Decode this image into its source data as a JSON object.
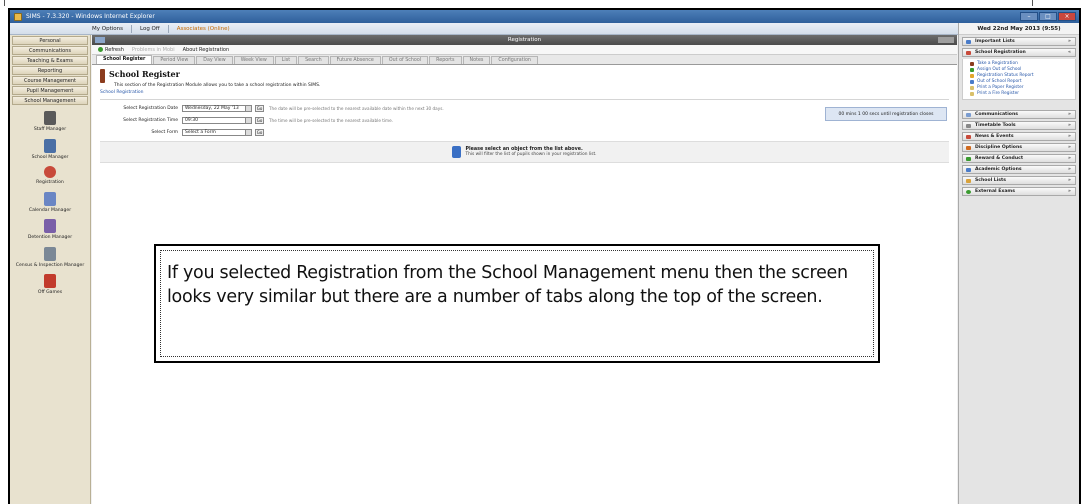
{
  "window": {
    "title": "SIMS - 7.3.320 - Windows Internet Explorer"
  },
  "toolbar": {
    "my_options": "My Options",
    "log_off": "Log Off",
    "user": "Associates (Online)"
  },
  "leftnav": {
    "menus": [
      "Personal",
      "Communications",
      "Teaching & Exams",
      "Reporting",
      "Course Management",
      "Pupil Management",
      "School Management"
    ],
    "tools": [
      "Staff Manager",
      "School Manager",
      "Registration",
      "Calendar Manager",
      "Detention Manager",
      "Census & Inspection Manager",
      "Off Games"
    ]
  },
  "panel": {
    "title": "Registration"
  },
  "subbar": {
    "refresh": "Refresh",
    "problem": "Problems in Mobi",
    "about": "About Registration"
  },
  "tabs": [
    "School Register",
    "Period View",
    "Day View",
    "Week View",
    "List",
    "Search",
    "Future Absence",
    "Out of School",
    "Reports",
    "Notes",
    "Configuration"
  ],
  "register": {
    "title": "School Register",
    "desc": "This section of the Registration Module allows you to take a school registration within SIMS.",
    "crumb": "School Registration",
    "countdown": "00 mins 1 00 secs until registration closes"
  },
  "form": {
    "date_label": "Select Registration Date",
    "date_value": "Wednesday, 22 May '13",
    "date_hint": "The date will be pre-selected to the nearest available date within the next 30 days.",
    "time_label": "Select Registration Time",
    "time_value": "09:30",
    "time_hint": "The time will be pre-selected to the nearest available time.",
    "form_label": "Select Form",
    "form_value": "Select a Form",
    "go": "Go"
  },
  "info": {
    "line1": "Please select an object from the list above.",
    "line2": "This will filter the list of pupils shown in your registration list."
  },
  "note": {
    "text": "If you selected Registration from the School Management menu then the screen looks very similar but there are a number of tabs along the top of the screen."
  },
  "right": {
    "date": "Wed 22nd May 2013 (9:55)",
    "sections_top": [
      "Important Lists",
      "School Registration"
    ],
    "links": [
      "Take a Registration",
      "Assign Out of School",
      "Registration Status Report",
      "Out of School Report",
      "Print a Paper Register",
      "Print a Fire Register"
    ],
    "sections": [
      "Communications",
      "Timetable Tools",
      "News & Events",
      "Discipline Options",
      "Reward & Conduct",
      "Academic Options",
      "School Lists",
      "External Exams"
    ]
  }
}
